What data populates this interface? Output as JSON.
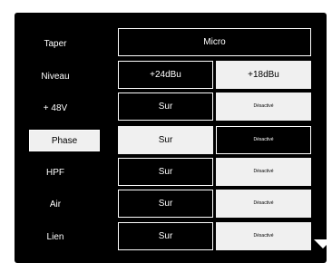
{
  "rows": [
    {
      "label": "Taper",
      "value": "Micro"
    },
    {
      "label": "Niveau",
      "left": "+24dBu",
      "right": "+18dBu"
    },
    {
      "label": "+ 48V",
      "left": "Sur",
      "right": "Désactivé"
    },
    {
      "label": "Phase",
      "left": "Sur",
      "right": "Désactivé"
    },
    {
      "label": "HPF",
      "left": "Sur",
      "right": "Désactivé"
    },
    {
      "label": "Air",
      "left": "Sur",
      "right": "Désactivé"
    },
    {
      "label": "Lien",
      "left": "Sur",
      "right": "Désactivé"
    }
  ],
  "scroll_down_icon": "triangle-down-icon"
}
